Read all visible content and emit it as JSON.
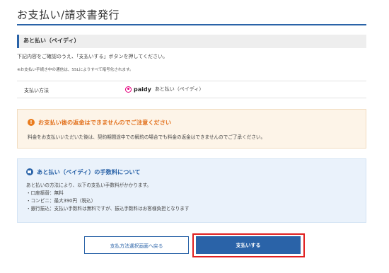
{
  "page": {
    "title": "お支払い/請求書発行"
  },
  "section": {
    "heading": "あと払い（ペイディ）",
    "intro": "下記内容をご確認のうえ、「支払いする」ボタンを押してください。",
    "ssl_note": "※お支払い手続き中の通信は、SSLによりすべて暗号化されます。"
  },
  "payment_method": {
    "label": "支払い方法",
    "logo_text": "paidy",
    "value": "あと払い（ペイディ）",
    "icon": "paidy-logo-icon",
    "brand_color": "#e6007e"
  },
  "warning": {
    "icon": "exclamation-icon",
    "title": "お支払い後の返金はできませんのでご注意ください",
    "body": "料金をお支払いいただいた後は、契約期間途中での解約の場合でも料金の返金はできませんのでご了承ください。",
    "color": "#e2711d"
  },
  "fee_info": {
    "icon": "megaphone-icon",
    "title": "あと払い（ペイディ）の手数料について",
    "lines": [
      "あと払いの方法により、以下の支払い手数料がかかります。",
      "・口座振替：無料",
      "・コンビニ：最大390円（税込）",
      "・銀行振込：支払い手数料は無料ですが、振込手数料はお客様負担となります"
    ],
    "color": "#2a63a8"
  },
  "actions": {
    "back_label": "支払方法選択画面へ戻る",
    "pay_label": "支払いする",
    "primary_color": "#2a63a8",
    "highlight_color": "#e02020"
  }
}
